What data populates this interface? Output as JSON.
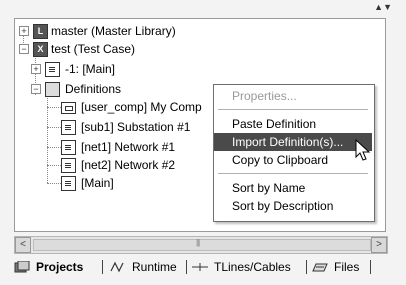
{
  "tree": {
    "items": [
      {
        "label": "master (Master Library)",
        "icon": "library-icon",
        "badge": "L"
      },
      {
        "label": "test (Test Case)",
        "icon": "testcase-icon",
        "badge": "X"
      },
      {
        "label": "-1: [Main]",
        "icon": "document-icon"
      },
      {
        "label": "Definitions",
        "icon": "definitions-icon"
      },
      {
        "label": "[user_comp] My Comp",
        "icon": "component-icon"
      },
      {
        "label": "[sub1] Substation #1",
        "icon": "document-icon"
      },
      {
        "label": "[net1] Network #1",
        "icon": "document-icon"
      },
      {
        "label": "[net2] Network #2",
        "icon": "document-icon"
      },
      {
        "label": "[Main]",
        "icon": "document-icon"
      }
    ],
    "expanders": {
      "plus": "+",
      "minus": "−"
    }
  },
  "context_menu": {
    "items": [
      {
        "label": "Properties...",
        "disabled": true
      },
      {
        "label": "Paste Definition"
      },
      {
        "label": "Import Definition(s)...",
        "highlighted": true
      },
      {
        "label": "Copy to Clipboard"
      },
      {
        "label": "Sort by Name"
      },
      {
        "label": "Sort by Description"
      }
    ]
  },
  "scrollbar": {
    "left_arrow": "<",
    "right_arrow": ">"
  },
  "tabs": [
    {
      "label": "Projects",
      "active": true,
      "icon": "projects-icon"
    },
    {
      "label": "Runtime",
      "icon": "runtime-icon"
    },
    {
      "label": "TLines/Cables",
      "icon": "tlines-icon"
    },
    {
      "label": "Files",
      "icon": "files-icon"
    }
  ],
  "colors": {
    "menu_highlight": "#4a4a4a",
    "tree_bg": "#ffffff",
    "panel_bg": "#f3f3f3"
  }
}
